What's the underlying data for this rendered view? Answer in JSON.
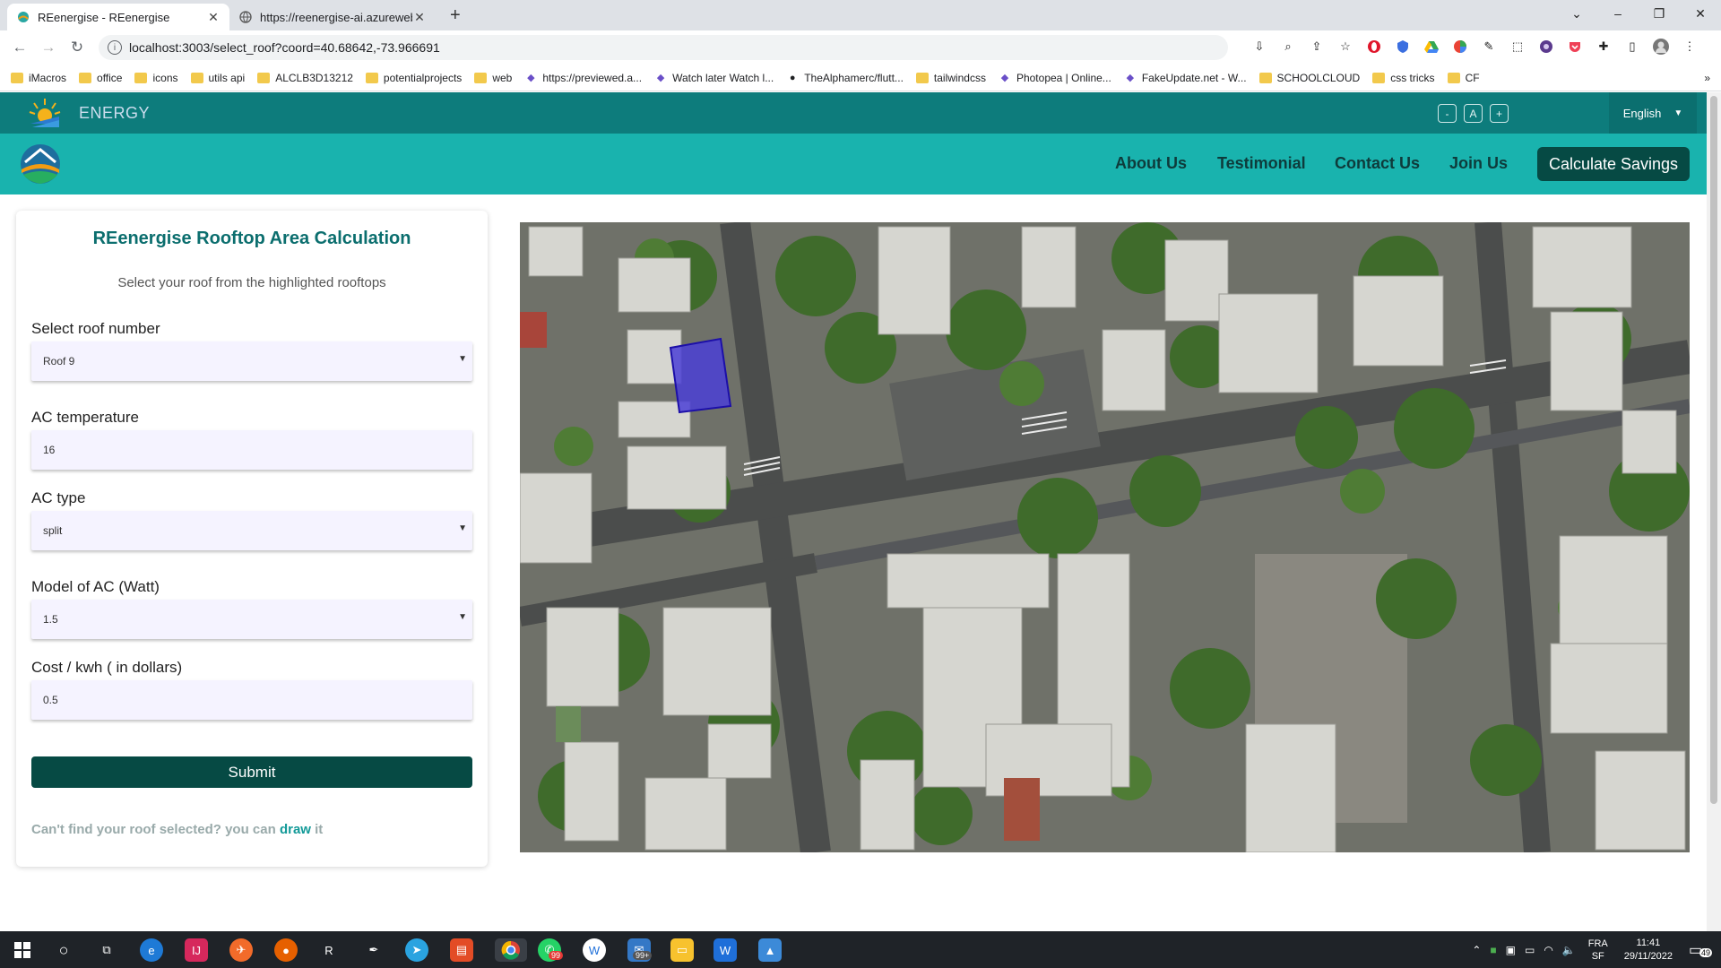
{
  "browser": {
    "tabs": [
      {
        "title": "REenergise - REenergise",
        "close": "✕"
      },
      {
        "title": "https://reenergise-ai.azurewebsit",
        "close": "✕"
      }
    ],
    "new_tab": "+",
    "url": "localhost:3003/select_roof?coord=40.68642,-73.966691",
    "bookmarks": [
      {
        "label": "iMacros",
        "type": "folder"
      },
      {
        "label": "office",
        "type": "folder"
      },
      {
        "label": "icons",
        "type": "folder"
      },
      {
        "label": "utils api",
        "type": "folder"
      },
      {
        "label": "ALCLB3D13212",
        "type": "folder"
      },
      {
        "label": "potentialprojects",
        "type": "folder"
      },
      {
        "label": "web",
        "type": "folder"
      },
      {
        "label": "https://previewed.a...",
        "type": "site"
      },
      {
        "label": "Watch later Watch l...",
        "type": "site"
      },
      {
        "label": "TheAlphamerc/flutt...",
        "type": "github"
      },
      {
        "label": "tailwindcss",
        "type": "folder"
      },
      {
        "label": "Photopea | Online...",
        "type": "site"
      },
      {
        "label": "FakeUpdate.net - W...",
        "type": "site"
      },
      {
        "label": "SCHOOLCLOUD",
        "type": "folder"
      },
      {
        "label": "css tricks",
        "type": "folder"
      },
      {
        "label": "CF",
        "type": "folder"
      }
    ]
  },
  "site": {
    "brand": "ENERGY",
    "font_controls": [
      "-",
      "A",
      "+"
    ],
    "language": "English",
    "nav": [
      "About Us",
      "Testimonial",
      "Contact Us",
      "Join Us"
    ],
    "cta": "Calculate Savings"
  },
  "form": {
    "title": "REenergise Rooftop Area Calculation",
    "subtitle": "Select your roof from the highlighted rooftops",
    "roof_label": "Select roof number",
    "roof_value": "Roof 9",
    "ac_temp_label": "AC temperature",
    "ac_temp_value": "16",
    "ac_type_label": "AC type",
    "ac_type_value": "split",
    "ac_model_label": "Model of AC (Watt)",
    "ac_model_value": "1.5",
    "cost_label": "Cost / kwh ( in dollars)",
    "cost_value": "0.5",
    "submit": "Submit",
    "hint_prefix": "Can't find your roof selected? you can",
    "hint_link": "draw",
    "hint_suffix": "it"
  },
  "taskbar": {
    "lang_top": "FRA",
    "lang_bottom": "SF",
    "time": "11:41",
    "date": "29/11/2022",
    "notifications": "49",
    "mail_badge": "99+",
    "whatsapp_badge": "99"
  },
  "colors": {
    "topbar": "#0d7c7c",
    "navbar": "#19b3ae",
    "primary_button": "#064a44",
    "title_teal": "#0b6e6e",
    "selected_roof": "#4b3fd6"
  }
}
